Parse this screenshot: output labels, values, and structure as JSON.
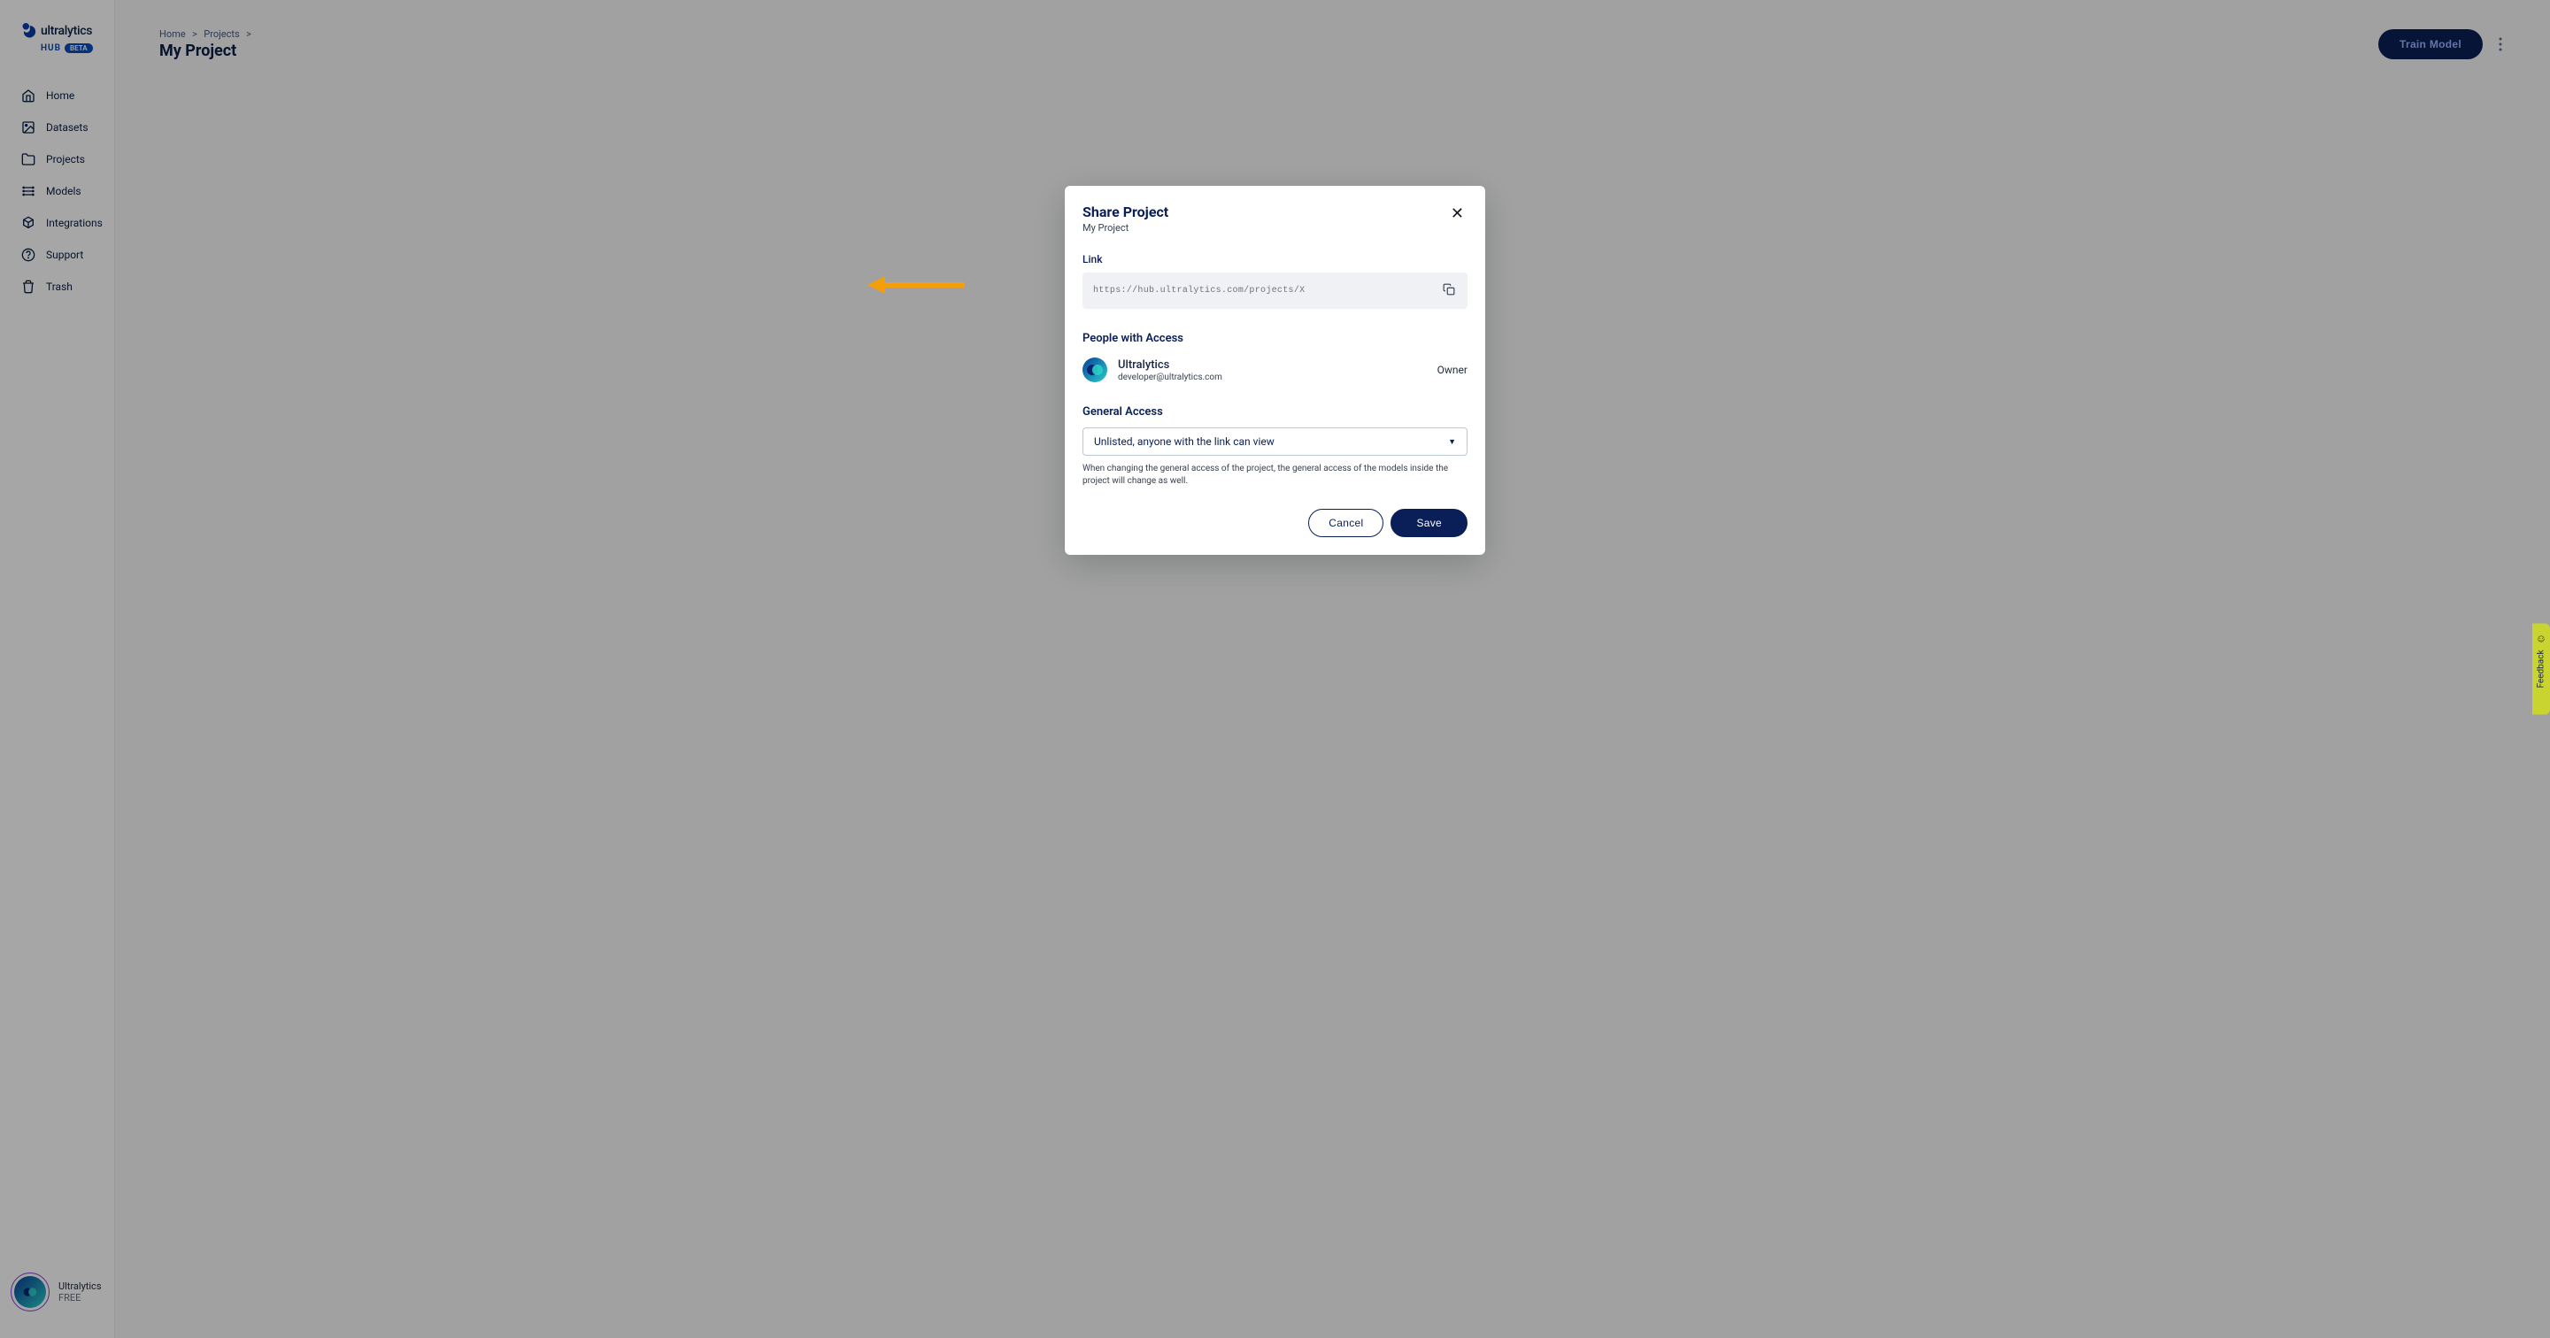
{
  "brand": {
    "name": "ultralytics",
    "hub": "HUB",
    "beta": "BETA"
  },
  "sidebar": {
    "items": [
      {
        "label": "Home",
        "icon": "home"
      },
      {
        "label": "Datasets",
        "icon": "dataset"
      },
      {
        "label": "Projects",
        "icon": "folder"
      },
      {
        "label": "Models",
        "icon": "model"
      },
      {
        "label": "Integrations",
        "icon": "integration"
      },
      {
        "label": "Support",
        "icon": "support"
      },
      {
        "label": "Trash",
        "icon": "trash"
      }
    ],
    "footer": {
      "name": "Ultralytics",
      "plan": "FREE"
    }
  },
  "header": {
    "breadcrumb": {
      "home": "Home",
      "projects": "Projects"
    },
    "title": "My Project",
    "train_button": "Train Model"
  },
  "dialog": {
    "title": "Share Project",
    "subtitle": "My Project",
    "link_label": "Link",
    "link_value": "https://hub.ultralytics.com/projects/X",
    "people_heading": "People with Access",
    "person": {
      "name": "Ultralytics",
      "email": "developer@ultralytics.com",
      "role": "Owner"
    },
    "general_heading": "General Access",
    "access_option": "Unlisted, anyone with the link can view",
    "helper": "When changing the general access of the project, the general access of the models inside the project will change as well.",
    "cancel": "Cancel",
    "save": "Save"
  },
  "feedback": "Feedback"
}
